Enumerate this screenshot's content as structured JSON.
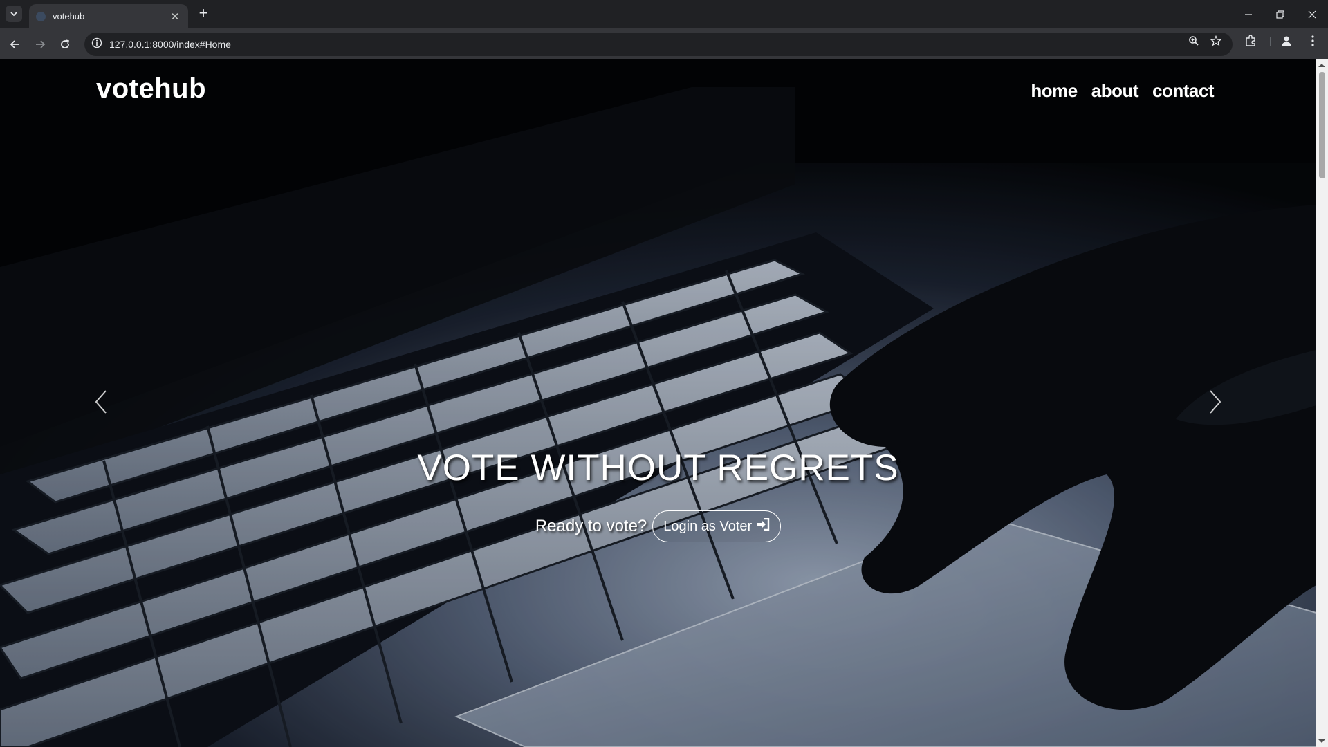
{
  "browser": {
    "tab_title": "votehub",
    "url": "127.0.0.1:8000/index#Home",
    "icons": [
      "tab-search-icon",
      "close-icon",
      "plus-icon",
      "minimize-icon",
      "restore-icon",
      "close-window-icon",
      "back-icon",
      "forward-icon",
      "reload-icon",
      "site-info-icon",
      "zoom-icon",
      "star-icon",
      "extensions-icon",
      "profile-icon",
      "menu-icon"
    ]
  },
  "site": {
    "logo": "votehub",
    "nav": [
      "home",
      "about",
      "contact"
    ]
  },
  "hero": {
    "headline": "VOTE WITHOUT REGRETS",
    "prompt": "Ready to vote?",
    "login_label": "Login as Voter",
    "login_icon": "sign-in-icon"
  }
}
